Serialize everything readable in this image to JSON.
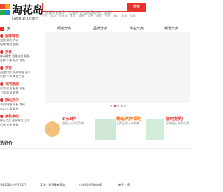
{
  "header": {
    "logo_name": "淘花岛",
    "logo_domain": "taonum.com",
    "search_placeholder": "搜狐人王储字（包装内容宝商品价格、前缀）",
    "search_button": "搜索",
    "hotwords": [
      "手机",
      "美妆",
      "连衣裙",
      "零食",
      "电脑",
      "女装",
      "男装",
      "手表",
      "箱包",
      "家电",
      "运动"
    ]
  },
  "nav": {
    "catbar_label": "类",
    "tabs": [
      "频道分类",
      "品牌分类",
      "淘宝分类",
      "频道分类"
    ]
  },
  "sidebar": {
    "categories": [
      {
        "name": "服饰鞋包",
        "subs": [
          "女装 男装 内衣",
          "鞋靴 箱包 配饰"
        ]
      },
      {
        "name": "美食",
        "subs": [
          "休闲零食 坚果炒货 果脯",
          "生鲜 水果 蔬菜 肉类"
        ]
      },
      {
        "name": "美妆",
        "subs": [
          "面霜 口红 隐形眼镜 香水",
          "彩妆 个护 美容工具"
        ]
      },
      {
        "name": "日用家居",
        "subs": [
          "家纺 家具 厨具 家装",
          "卫浴 灯具 收纳"
        ]
      },
      {
        "name": "数码办公",
        "subs": [
          "手机 电脑 平板 数码",
          "办公 文具 耳机"
        ]
      },
      {
        "name": "家装家纺",
        "subs": [
          "床上用品 居家布艺 卫浴",
          "灯饰 五金 装修"
        ]
      }
    ]
  },
  "promos": [
    {
      "title": "3元3件",
      "sub": "超值一元好货包邮"
    },
    {
      "title": "精选大牌福利",
      "sub": "大牌品质 一件包邮"
    },
    {
      "title": "限时抢购",
      "sub": "好物低价 先到先得"
    }
  ],
  "section": {
    "title": "选好价"
  },
  "items": [
    "元1000亿人民币买了",
    "128个免费最新版本",
    "小米相关手机电视",
    "新号工牌"
  ],
  "colors": {
    "brand_red": "#e9322c",
    "promo_orange": "#ff6a00",
    "promo_green": "#25a36a"
  }
}
